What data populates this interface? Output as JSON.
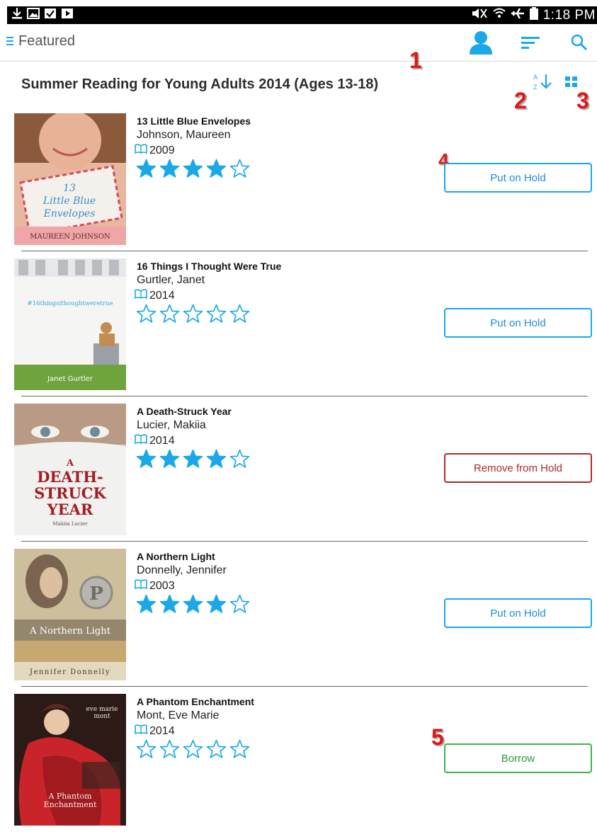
{
  "status_bar": {
    "time": "1:18 PM"
  },
  "header": {
    "title": "Featured",
    "icons": [
      "menu-icon",
      "account-icon",
      "filter-icon",
      "search-icon"
    ]
  },
  "collection": {
    "title": "Summer Reading for Young Adults 2014 (Ages 13-18)",
    "tools": [
      "sort-az-icon",
      "grid-view-icon"
    ]
  },
  "annotations": [
    "1",
    "2",
    "3",
    "4",
    "5"
  ],
  "colors": {
    "accent": "#1ba8e6",
    "hold": "#1ba8e6",
    "remove": "#b02828",
    "borrow": "#3bb54a"
  },
  "books": [
    {
      "title": "13 Little Blue Envelopes",
      "author": "Johnson, Maureen",
      "year": "2009",
      "rating": 4,
      "action": "Put on Hold",
      "cover_text": [
        "13",
        "Little Blue",
        "Envelopes",
        "MAUREEN JOHNSON"
      ]
    },
    {
      "title": "16 Things I Thought Were True",
      "author": "Gurtler, Janet",
      "year": "2014",
      "rating": 0,
      "action": "Put on Hold",
      "cover_text": [
        "#16thingsithoughtweretrue",
        "Janet Gurtler"
      ]
    },
    {
      "title": "A Death-Struck Year",
      "author": "Lucier, Makiia",
      "year": "2014",
      "rating": 4,
      "action": "Remove from Hold",
      "cover_text": [
        "A",
        "DEATH-",
        "STRUCK",
        "YEAR",
        "Makiia Lucier"
      ]
    },
    {
      "title": "A Northern Light",
      "author": "Donnelly, Jennifer",
      "year": "2003",
      "rating": 4,
      "action": "Put on Hold",
      "cover_text": [
        "P",
        "A Northern Light",
        "Jennifer Donnelly"
      ]
    },
    {
      "title": "A Phantom Enchantment",
      "author": "Mont, Eve Marie",
      "year": "2014",
      "rating": 0,
      "action": "Borrow",
      "cover_text": [
        "eve marie",
        "mont",
        "A Phantom",
        "Enchantment"
      ]
    }
  ]
}
